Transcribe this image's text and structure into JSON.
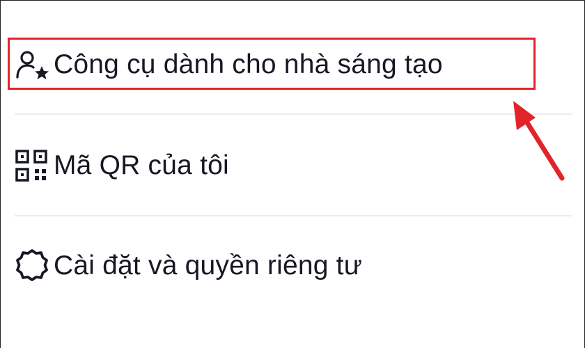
{
  "menu": {
    "items": [
      {
        "label": "Công cụ dành cho nhà sáng tạo",
        "icon": "creator-star-icon"
      },
      {
        "label": "Mã QR của tôi",
        "icon": "qr-code-icon"
      },
      {
        "label": "Cài đặt và quyền riêng tư",
        "icon": "gear-icon"
      }
    ]
  },
  "annotation": {
    "highlight_color": "#e0242a",
    "highlighted_item": "Công cụ dành cho nhà sáng tạo"
  },
  "colors": {
    "text": "#161823",
    "divider": "#ececec",
    "background": "#ffffff"
  }
}
